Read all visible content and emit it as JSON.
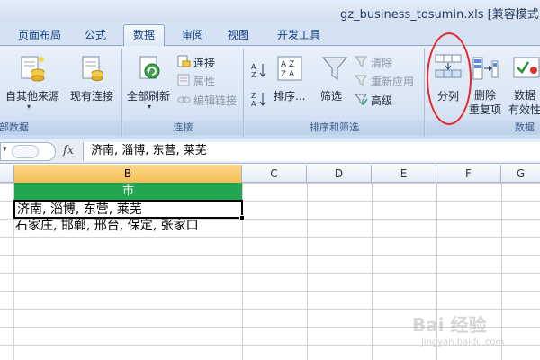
{
  "window": {
    "title": "gz_business_tosumin.xls  [兼容模式]"
  },
  "tabs": [
    "页面布局",
    "公式",
    "数据",
    "审阅",
    "视图",
    "开发工具"
  ],
  "active_tab": "数据",
  "ribbon": {
    "get_external": {
      "button": "自其他来源",
      "existing": "现有连接",
      "group": "外部数据"
    },
    "connections": {
      "refresh_all": "全部刷新",
      "connections": "连接",
      "properties": "属性",
      "edit_links": "编辑链接",
      "group": "连接"
    },
    "sort_filter": {
      "sort": "排序...",
      "filter": "筛选",
      "clear": "清除",
      "reapply": "重新应用",
      "advanced": "高级",
      "group": "排序和筛选"
    },
    "data_tools": {
      "text_to_columns": "分列",
      "remove_duplicates_1": "删除",
      "remove_duplicates_2": "重复项",
      "validation_1": "数据",
      "validation_2": "有效性",
      "group": "数据"
    }
  },
  "formula_bar": {
    "fx_label": "fx",
    "value": "济南, 淄博, 东营, 莱芜"
  },
  "columns": [
    "B",
    "C",
    "D",
    "E",
    "F",
    "G"
  ],
  "selected_column": "B",
  "cells": {
    "header": "市",
    "row1": "济南, 淄博, 东营, 莱芜",
    "row2": "石家庄, 邯郸, 邢台, 保定, 张家口"
  },
  "watermark": {
    "line1": "Bai 经验",
    "line2": "jingyan.baidu.com"
  },
  "colors": {
    "header_fill": "#21a74f",
    "annotation": "#e8262a",
    "selected_col": "#f6be55"
  }
}
